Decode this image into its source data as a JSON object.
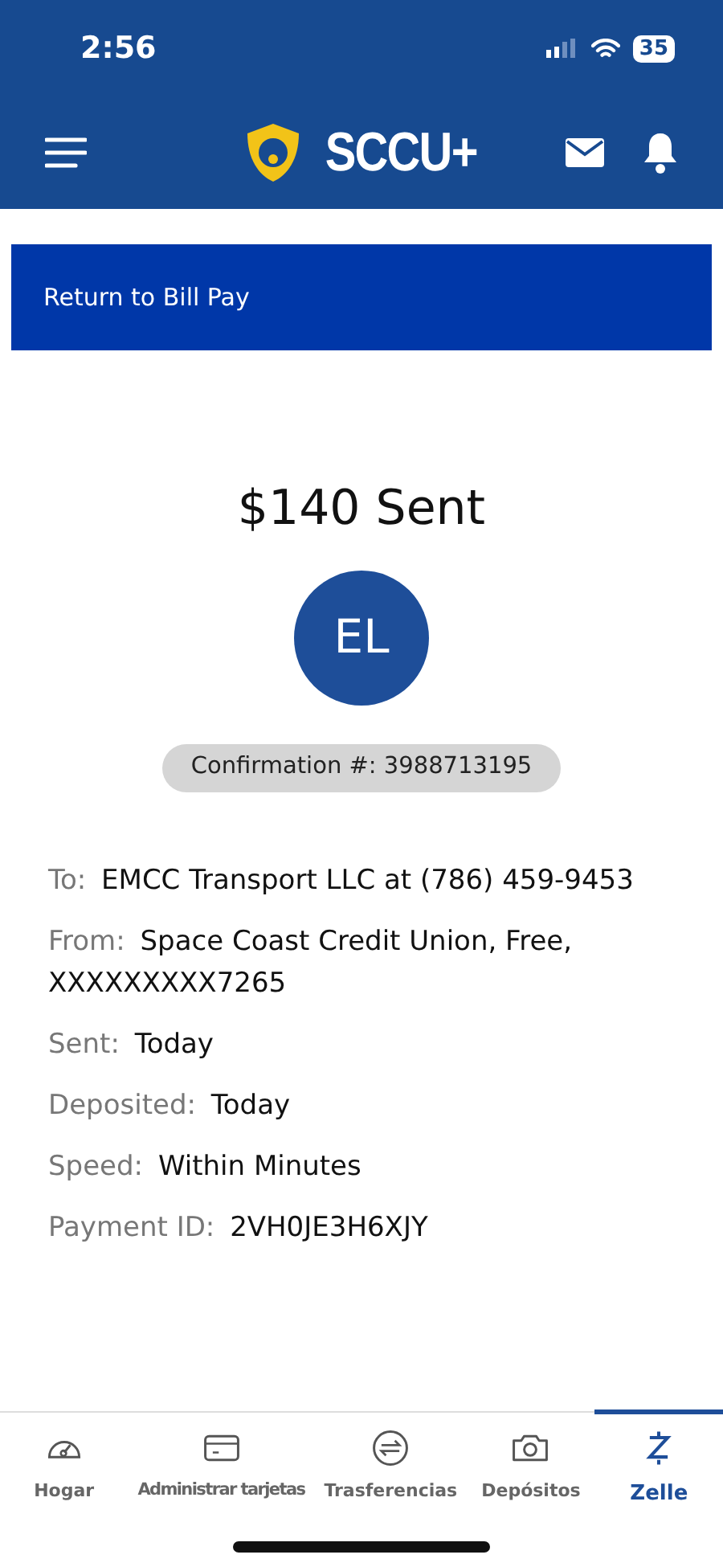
{
  "status_bar": {
    "time": "2:56",
    "battery": "35"
  },
  "header": {
    "logo_text": "SCCU+"
  },
  "return_button": {
    "label": "Return to Bill Pay"
  },
  "title": "$140 Sent",
  "avatar": {
    "initials": "EL"
  },
  "confirmation": "Confirmation #: 3988713195",
  "details": [
    {
      "label": "To:",
      "value": "EMCC Transport LLC at (786) 459-9453"
    },
    {
      "label": "From:",
      "value": "Space Coast Credit Union, Free, XXXXXXXXX7265"
    },
    {
      "label": "Sent:",
      "value": "Today"
    },
    {
      "label": "Deposited:",
      "value": "Today"
    },
    {
      "label": "Speed:",
      "value": "Within Minutes"
    },
    {
      "label": "Payment ID:",
      "value": "2VH0JE3H6XJY"
    }
  ],
  "tabs": [
    {
      "label": "Hogar",
      "kind": "gauge",
      "selected": false
    },
    {
      "label": "Administrar tarjetas",
      "kind": "card",
      "selected": false
    },
    {
      "label": "Trasferencias",
      "kind": "transfer",
      "selected": false
    },
    {
      "label": "Depósitos",
      "kind": "camera",
      "selected": false
    },
    {
      "label": "Zelle",
      "kind": "zelle",
      "selected": true
    }
  ]
}
